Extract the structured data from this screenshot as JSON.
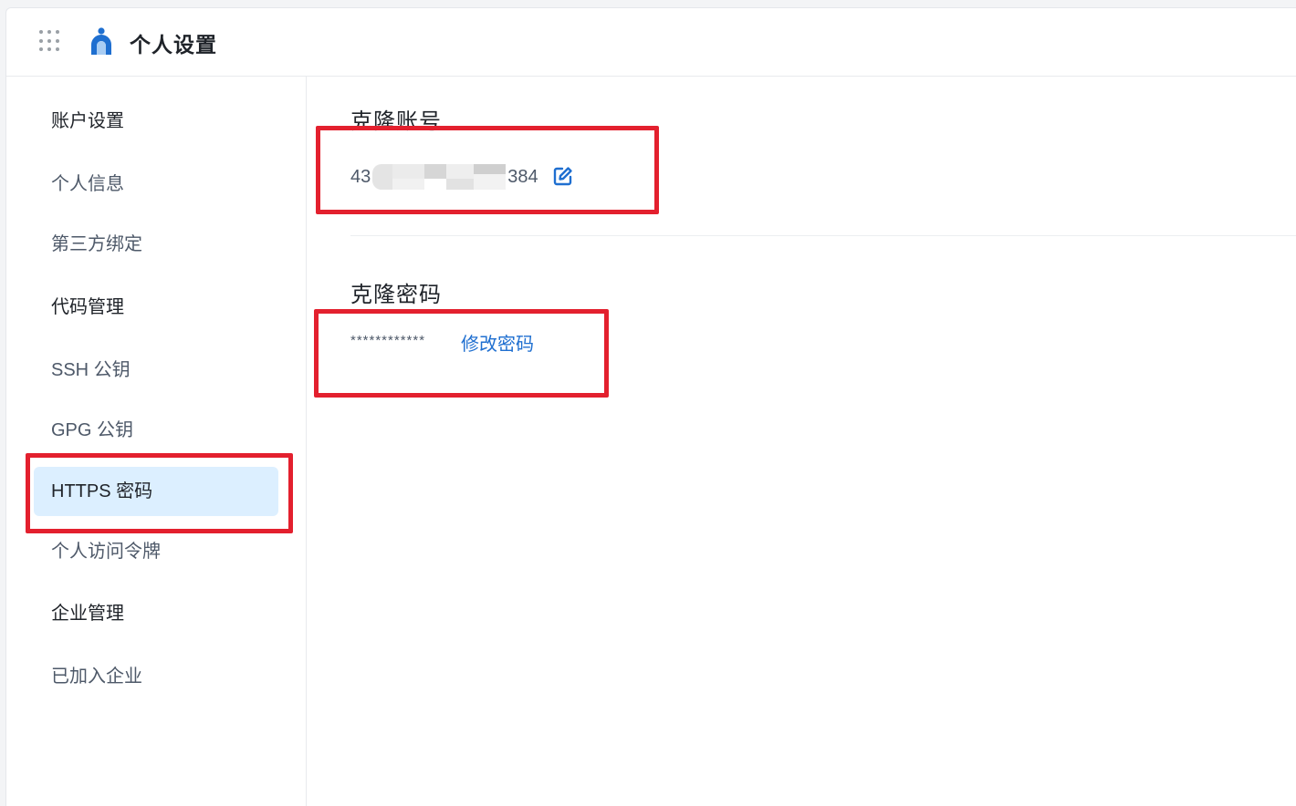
{
  "header": {
    "title": "个人设置",
    "app_grid_icon": "app-grid-icon",
    "logo_icon": "person-logo-icon"
  },
  "sidebar": {
    "items": [
      {
        "label": "账户设置",
        "type": "group"
      },
      {
        "label": "个人信息",
        "type": "item"
      },
      {
        "label": "第三方绑定",
        "type": "item"
      },
      {
        "label": "代码管理",
        "type": "group"
      },
      {
        "label": "SSH 公钥",
        "type": "item"
      },
      {
        "label": "GPG 公钥",
        "type": "item"
      },
      {
        "label": "HTTPS 密码",
        "type": "item",
        "active": true
      },
      {
        "label": "个人访问令牌",
        "type": "item"
      },
      {
        "label": "企业管理",
        "type": "group"
      },
      {
        "label": "已加入企业",
        "type": "item"
      }
    ]
  },
  "main": {
    "clone_account": {
      "title": "克隆账号",
      "value_prefix": "43",
      "value_suffix": "384",
      "edit_icon": "edit-icon"
    },
    "clone_password": {
      "title": "克隆密码",
      "masked_value": "************",
      "change_label": "修改密码"
    }
  },
  "colors": {
    "accent": "#1f6fd0",
    "active_bg": "#dcefff",
    "highlight_box": "#e3202e",
    "logo_blue": "#1f6fd0"
  }
}
